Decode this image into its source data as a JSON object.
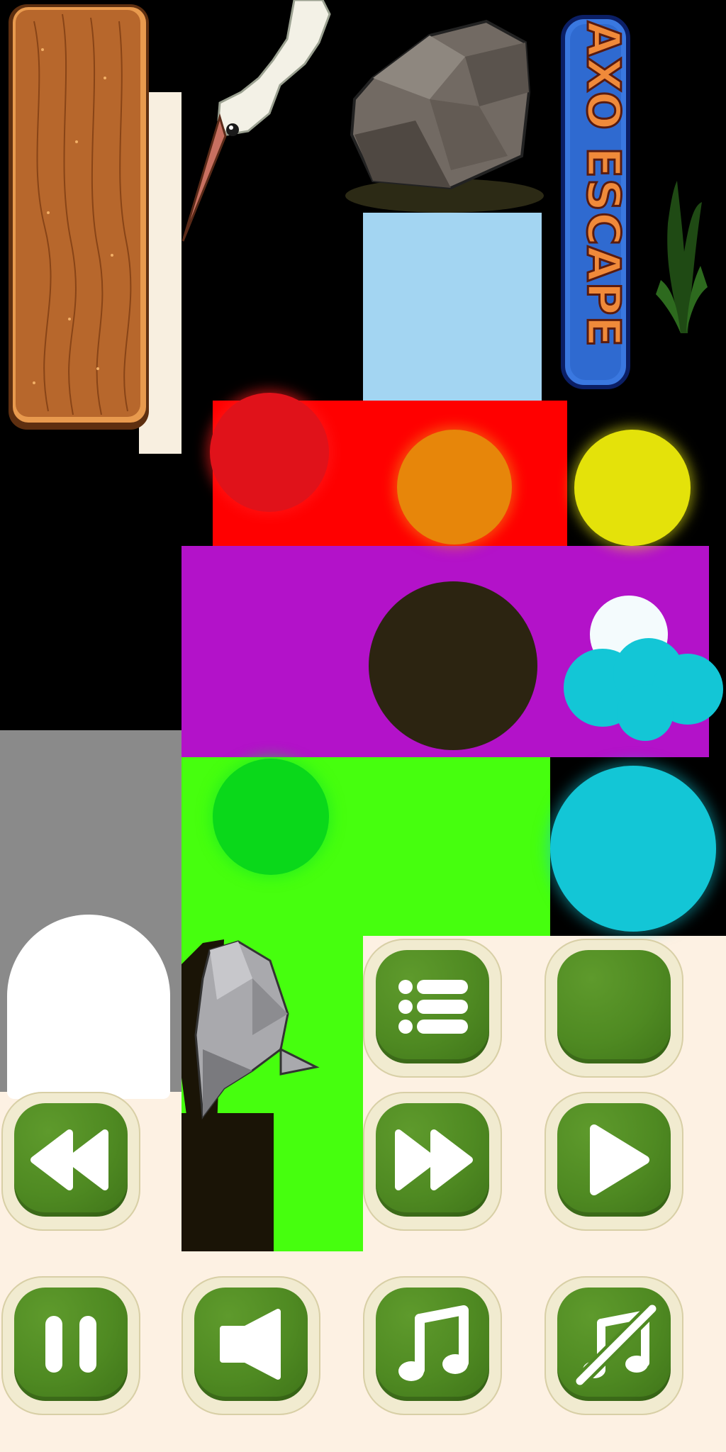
{
  "game": {
    "title": "AXO ESCAPE"
  },
  "colors": {
    "wood": "#b5652c",
    "red_orb": "#e0121a",
    "orange_orb": "#e7860a",
    "yellow_orb": "#e4e20a",
    "dark_orb": "#2c2411",
    "cyan_orb": "#13c6d6",
    "green_orb": "#0ad81a",
    "button_green": "#4f8a22",
    "button_cream": "#f1ebd0",
    "swatch_sky": "#a3d5f2",
    "swatch_red": "#ff0000",
    "swatch_purple": "#b312c9",
    "swatch_lime": "#46ff0e",
    "swatch_cream": "#fdf1e3"
  },
  "buttons": [
    {
      "name": "menu-button",
      "icon": "menu-icon"
    },
    {
      "name": "blank-button",
      "icon": "none"
    },
    {
      "name": "rewind-button",
      "icon": "rewind-icon"
    },
    {
      "name": "fast-forward-button",
      "icon": "fast-forward-icon"
    },
    {
      "name": "play-button",
      "icon": "play-icon"
    },
    {
      "name": "pause-button",
      "icon": "pause-icon"
    },
    {
      "name": "sound-button",
      "icon": "speaker-icon"
    },
    {
      "name": "music-button",
      "icon": "music-note-icon"
    },
    {
      "name": "music-off-button",
      "icon": "music-off-icon"
    }
  ]
}
